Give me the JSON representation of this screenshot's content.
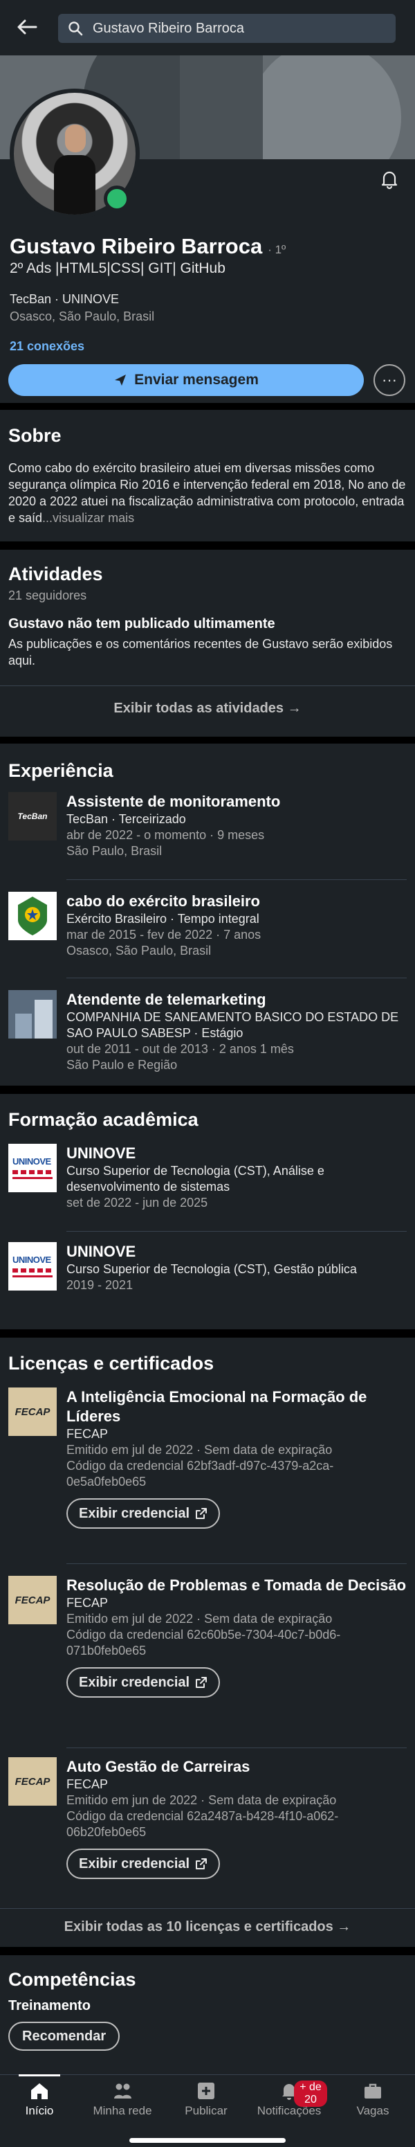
{
  "search": {
    "value": "Gustavo Ribeiro Barroca"
  },
  "profile": {
    "name": "Gustavo Ribeiro Barroca",
    "degree": "· 1º",
    "headline": "2º Ads |HTML5|CSS| GIT| GitHub",
    "company": "TecBan · UNINOVE",
    "location": "Osasco, São Paulo, Brasil",
    "connections": "21 conexões",
    "message_label": "Enviar mensagem",
    "more_label": "···"
  },
  "about": {
    "title": "Sobre",
    "text": "Como cabo do exército brasileiro atuei em diversas missões como segurança olímpica Rio 2016 e intervenção federal em 2018, No ano de 2020 a 2022 atuei na fiscalização administrativa com protocolo, entrada e saíd",
    "more": "...visualizar mais"
  },
  "activity": {
    "title": "Atividades",
    "followers": "21 seguidores",
    "heading": "Gustavo não tem publicado ultimamente",
    "description": "As publicações e os comentários recentes de Gustavo serão exibidos aqui.",
    "footer": "Exibir todas as atividades →"
  },
  "experience": {
    "title": "Experiência",
    "items": [
      {
        "title": "Assistente de monitoramento",
        "line1": "TecBan · Terceirizado",
        "line2": "abr de 2022 - o momento · 9 meses",
        "line3": "São Paulo, Brasil",
        "logo": "TecBan"
      },
      {
        "title": "cabo do exército brasileiro",
        "line1": "Exército Brasileiro · Tempo integral",
        "line2": "mar de 2015 - fev de 2022 · 7 anos",
        "line3": "Osasco, São Paulo, Brasil",
        "logo": "exercito-brasileiro-emblem"
      },
      {
        "title": "Atendente de telemarketing",
        "line1": "COMPANHIA DE SANEAMENTO BASICO DO ESTADO DE SAO PAULO SABESP · Estágio",
        "line2": "out de 2011 - out de 2013 · 2 anos 1 mês",
        "line3": "São Paulo e Região",
        "logo": "company-placeholder"
      }
    ]
  },
  "education": {
    "title": "Formação acadêmica",
    "logo_text": "UNINOVE",
    "items": [
      {
        "school": "UNINOVE",
        "degree": "Curso Superior de Tecnologia (CST), Análise e desenvolvimento de sistemas",
        "dates": "set de 2022 - jun de 2025"
      },
      {
        "school": "UNINOVE",
        "degree": "Curso Superior de Tecnologia (CST), Gestão pública",
        "dates": "2019 - 2021"
      }
    ]
  },
  "licenses": {
    "title": "Licenças e certificados",
    "logo_text": "FECAP",
    "button_label": "Exibir credencial",
    "items": [
      {
        "title": "A Inteligência Emocional na Formação de Líderes",
        "issuer": "FECAP",
        "meta": "Emitido em jul de 2022 · Sem data de expiração",
        "credential": "Código da credencial 62bf3adf-d97c-4379-a2ca-0e5a0feb0e65"
      },
      {
        "title": "Resolução de Problemas e Tomada de Decisão",
        "issuer": "FECAP",
        "meta": "Emitido em jul de 2022 · Sem data de expiração",
        "credential": "Código da credencial 62c60b5e-7304-40c7-b0d6-071b0feb0e65"
      },
      {
        "title": "Auto Gestão de Carreiras",
        "issuer": "FECAP",
        "meta": "Emitido em jun de 2022 · Sem data de expiração",
        "credential": "Código da credencial 62a2487a-b428-4f10-a062-06b20feb0e65"
      }
    ],
    "footer": "Exibir todas as 10 licenças e certificados →"
  },
  "skills": {
    "title": "Competências",
    "first": "Treinamento",
    "recommend_label": "Recomendar"
  },
  "nav": {
    "home": "Início",
    "network": "Minha rede",
    "post": "Publicar",
    "notifications": "Notificações",
    "notifications_badge": "+ de 20",
    "jobs": "Vagas"
  },
  "colors": {
    "accent": "#71b7fb",
    "surface": "#1d2226",
    "online": "#2cbb6e",
    "badge": "#cb112d"
  }
}
